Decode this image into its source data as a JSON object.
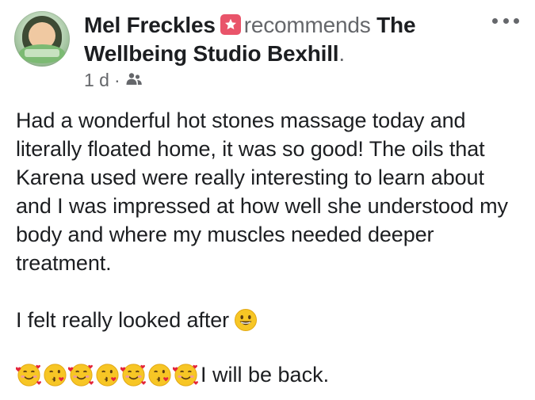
{
  "post": {
    "author": "Mel Freckles",
    "action": "recommends",
    "page_name": "The Wellbeing Studio Bexhill",
    "period": ".",
    "time": "1 d",
    "meta_dot": "·",
    "paragraphs": [
      "Had a wonderful hot stones massage today and literally floated home, it was so good! The oils that Karena used were really interesting to learn about and I was impressed at how well she understood my body and where my muscles needed deeper treatment.",
      "I felt really looked after"
    ],
    "closing": "I will be back."
  },
  "icons": {
    "recommend": "recommend-badge-icon",
    "audience": "friends-audience-icon",
    "more": "more-options-icon",
    "smile": "grinning-face-emoji",
    "emoji_sequence": [
      "smiling-face-with-hearts",
      "face-blowing-kiss",
      "smiling-face-with-hearts",
      "face-blowing-kiss",
      "smiling-face-with-hearts",
      "face-blowing-kiss",
      "smiling-face-with-hearts"
    ]
  },
  "colors": {
    "recommend_badge": "#e9546a",
    "secondary_text": "#65676b",
    "primary_text": "#1c1e21"
  }
}
